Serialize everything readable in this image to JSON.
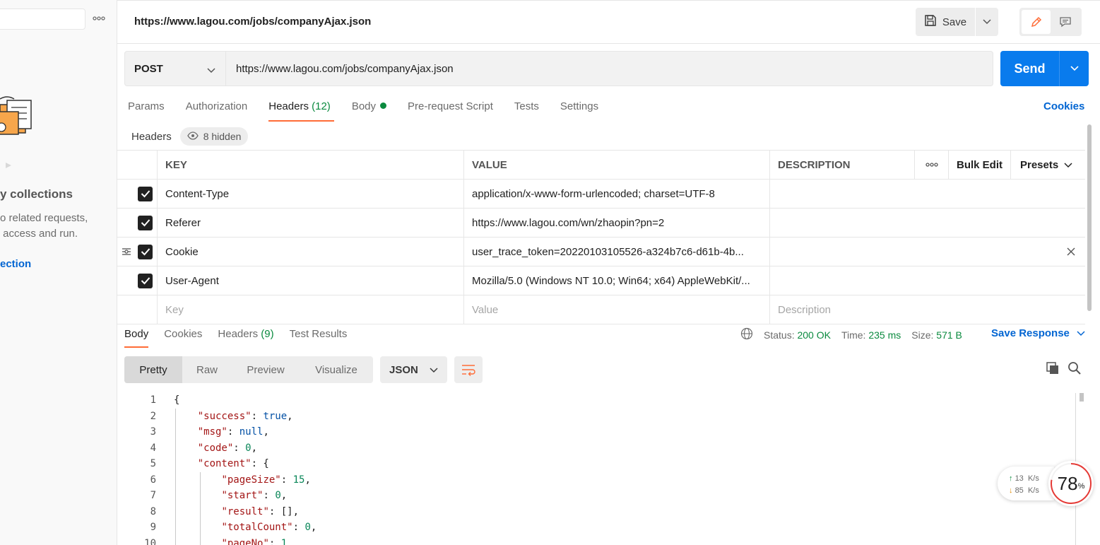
{
  "sidebar": {
    "title": "y collections",
    "desc_line1": "o related requests,",
    "desc_line2": " access and run.",
    "link": "ection"
  },
  "request": {
    "name": "https://www.lagou.com/jobs/companyAjax.json",
    "save_label": "Save",
    "method": "POST",
    "url": "https://www.lagou.com/jobs/companyAjax.json",
    "send_label": "Send"
  },
  "req_tabs": {
    "params": "Params",
    "authorization": "Authorization",
    "headers": "Headers",
    "headers_count": "(12)",
    "body": "Body",
    "prerequest": "Pre-request Script",
    "tests": "Tests",
    "settings": "Settings",
    "cookies": "Cookies"
  },
  "headers_section": {
    "label": "Headers",
    "hidden": "8 hidden"
  },
  "headers_table": {
    "col_key": "KEY",
    "col_value": "VALUE",
    "col_desc": "DESCRIPTION",
    "bulk_edit": "Bulk Edit",
    "presets": "Presets",
    "rows": [
      {
        "key": "Content-Type",
        "value": "application/x-www-form-urlencoded; charset=UTF-8"
      },
      {
        "key": "Referer",
        "value": "https://www.lagou.com/wn/zhaopin?pn=2"
      },
      {
        "key": "Cookie",
        "value": "user_trace_token=20220103105526-a324b7c6-d61b-4b..."
      },
      {
        "key": "User-Agent",
        "value": "Mozilla/5.0 (Windows NT 10.0; Win64; x64) AppleWebKit/..."
      }
    ],
    "placeholder_key": "Key",
    "placeholder_value": "Value",
    "placeholder_desc": "Description"
  },
  "response": {
    "tabs": {
      "body": "Body",
      "cookies": "Cookies",
      "headers": "Headers",
      "headers_count": "(9)",
      "test_results": "Test Results"
    },
    "status_label": "Status:",
    "status": "200 OK",
    "time_label": "Time:",
    "time": "235 ms",
    "size_label": "Size:",
    "size": "571 B",
    "save_response": "Save Response",
    "formats": {
      "pretty": "Pretty",
      "raw": "Raw",
      "preview": "Preview",
      "visualize": "Visualize"
    },
    "language": "JSON",
    "lines": [
      "1",
      "2",
      "3",
      "4",
      "5",
      "6",
      "7",
      "8",
      "9",
      "10"
    ]
  },
  "net_widget": {
    "up": "13",
    "down": "85",
    "unit": "K/s",
    "percent": "78",
    "percent_sign": "%"
  },
  "colors": {
    "accent": "#ff6c37",
    "send": "#097bed",
    "link": "#0265d2",
    "success": "#0a8a3e"
  }
}
